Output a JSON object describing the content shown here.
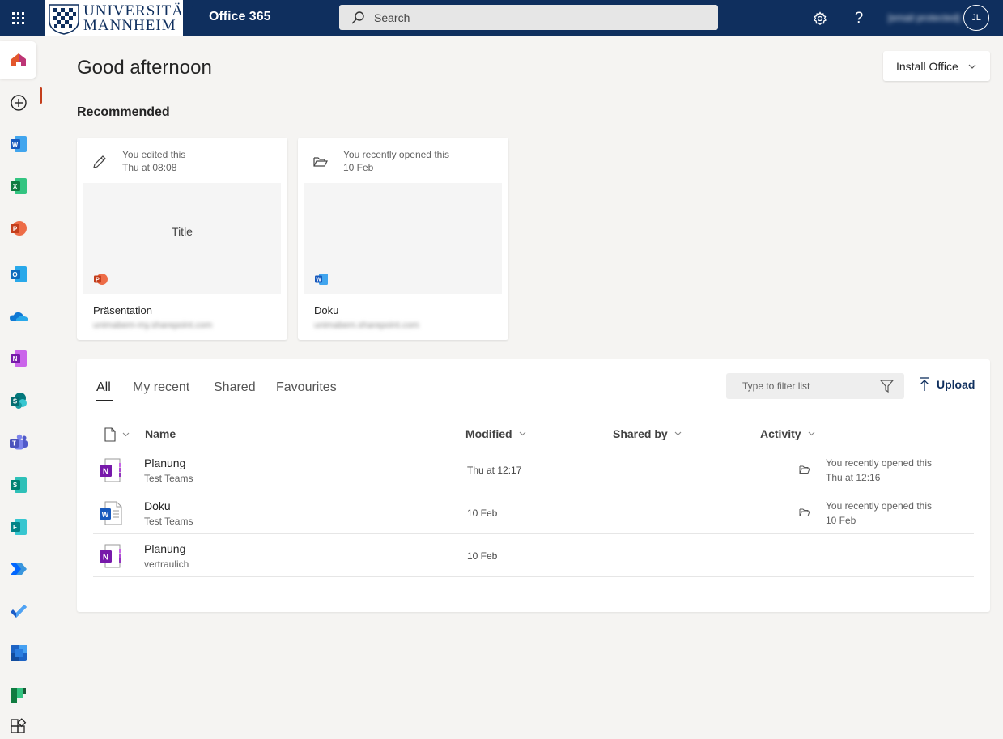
{
  "header": {
    "logo_line1": "UNIVERSITÄT",
    "logo_line2": "MANNHEIM",
    "app_title": "Office 365",
    "search_label": "Search",
    "user_email": "[email protected]",
    "avatar_initials": "JL",
    "bar_color": "#0f2f5e"
  },
  "help_glyph": "?",
  "greeting": "Good afternoon",
  "install_office": "Install Office",
  "recommended": {
    "title": "Recommended",
    "cards": [
      {
        "line1": "You edited this",
        "line2": "Thu at 08:08",
        "thumb_title": "Title",
        "name": "Präsentation",
        "url": "unimabem-my.sharepoint.com",
        "app": "powerpoint"
      },
      {
        "line1": "You recently opened this",
        "line2": "10 Feb",
        "thumb_title": "",
        "name": "Doku",
        "url": "unimabem.sharepoint.com",
        "app": "word"
      }
    ]
  },
  "files": {
    "tabs": [
      "All",
      "My recent",
      "Shared",
      "Favourites"
    ],
    "filter_placeholder": "Type to filter list",
    "upload_label": "Upload",
    "columns": {
      "name": "Name",
      "modified": "Modified",
      "shared_by": "Shared by",
      "activity": "Activity"
    },
    "rows": [
      {
        "name": "Planung",
        "location": "Test Teams",
        "modified": "Thu at 12:17",
        "activity1": "You recently opened this",
        "activity2": "Thu at 12:16",
        "app": "onenote"
      },
      {
        "name": "Doku",
        "location": "Test Teams",
        "modified": "10 Feb",
        "activity1": "You recently opened this",
        "activity2": "10 Feb",
        "app": "word"
      },
      {
        "name": "Planung",
        "location": "vertraulich",
        "modified": "10 Feb",
        "activity1": "",
        "activity2": "",
        "app": "onenote"
      }
    ]
  },
  "rail_apps": [
    "home",
    "create",
    "word",
    "excel",
    "powerpoint",
    "outlook",
    "onedrive",
    "onenote",
    "sharepoint",
    "teams",
    "sway",
    "forms",
    "power-automate",
    "to-do",
    "stream",
    "planner",
    "all-apps"
  ],
  "colors": {
    "word": "#185abd",
    "excel": "#107c41",
    "powerpoint": "#c43e1c",
    "outlook": "#0f6cbd",
    "onenote": "#7719aa",
    "sharepoint": "#036c70",
    "teams": "#5059c9",
    "accent_home": "#c43e1c"
  }
}
